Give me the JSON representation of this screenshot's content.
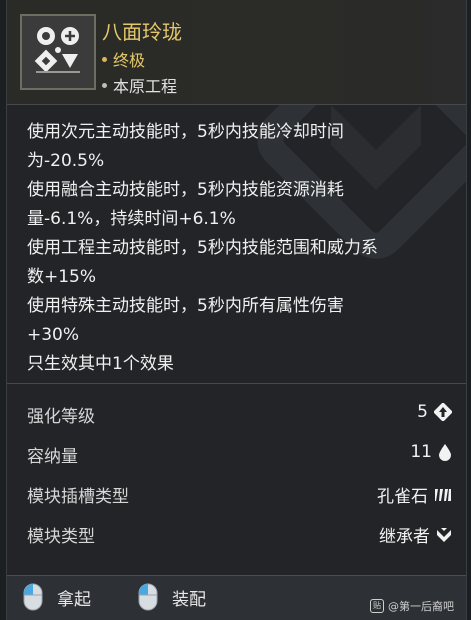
{
  "item": {
    "name": "八面玲珑",
    "rarity": "终极",
    "source": "本原工程",
    "icon": "module-emblem-icon"
  },
  "description": [
    "使用次元主动技能时，5秒内技能冷却时间",
    "为-20.5%",
    "使用融合主动技能时，5秒内技能资源消耗",
    "量-6.1%，持续时间+6.1%",
    "使用工程主动技能时，5秒内技能范围和威力系",
    "数+15%",
    "使用特殊主动技能时，5秒内所有属性伤害",
    "+30%",
    "只生效其中1个效果"
  ],
  "stats": [
    {
      "label": "强化等级",
      "value": "5",
      "icon": "enhance-level-icon"
    },
    {
      "label": "容纳量",
      "value": "11",
      "icon": "capacity-drop-icon"
    },
    {
      "label": "模块插槽类型",
      "value": "孔雀石",
      "icon": "malachite-socket-icon"
    },
    {
      "label": "模块类型",
      "value": "继承者",
      "icon": "descendant-type-icon"
    }
  ],
  "actions": {
    "pickup_label": "拿起",
    "equip_label": "装配"
  },
  "watermark": {
    "text": "@第一后裔吧",
    "badge": "贴"
  },
  "colors": {
    "title_gold": "#e5c86b",
    "panel_bg": "#222428",
    "footer_bg": "#2d3034"
  }
}
